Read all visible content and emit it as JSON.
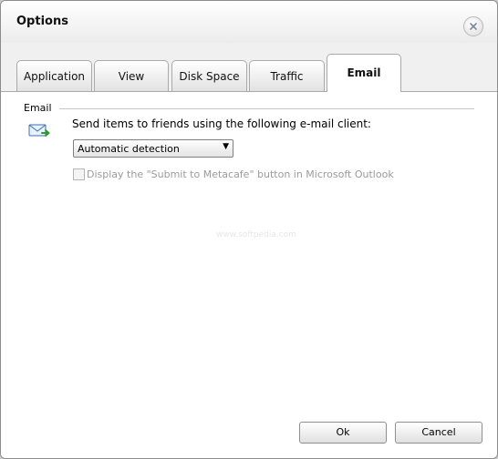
{
  "window": {
    "title": "Options"
  },
  "tabs": [
    {
      "label": "Application"
    },
    {
      "label": "View"
    },
    {
      "label": "Disk Space"
    },
    {
      "label": "Traffic"
    },
    {
      "label": "Email",
      "active": true
    }
  ],
  "email_group": {
    "label": "Email",
    "icon": "email-icon",
    "send_text": "Send items to friends using the following e-mail client:",
    "client_select": {
      "value": "Automatic detection"
    },
    "outlook_checkbox": {
      "label": "Display the \"Submit to Metacafe\" button in Microsoft Outlook",
      "checked": false,
      "enabled": false
    }
  },
  "watermark": {
    "text": "www.softpedia.com"
  },
  "buttons": {
    "ok": "Ok",
    "cancel": "Cancel"
  },
  "colors": {
    "window_bg": "#f0f0f0",
    "panel_bg": "#ffffff",
    "disabled_text": "#9b9b9b"
  }
}
